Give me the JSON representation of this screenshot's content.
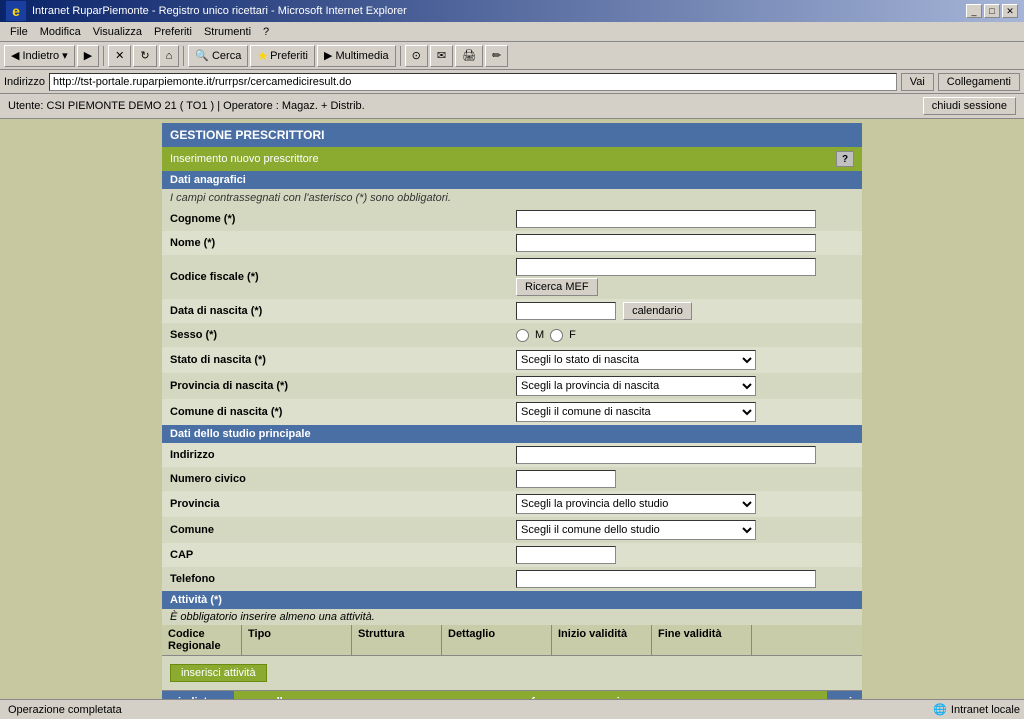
{
  "window": {
    "title": "Intranet RuparPiemonte - Registro unico ricettari - Microsoft Internet Explorer",
    "controls": [
      "_",
      "□",
      "✕"
    ]
  },
  "menu": {
    "items": [
      "File",
      "Modifica",
      "Visualizza",
      "Preferiti",
      "Strumenti",
      "?"
    ]
  },
  "toolbar": {
    "back": "Indietro",
    "forward": "▶",
    "stop": "✕",
    "refresh": "↻",
    "home": "⌂",
    "search": "Cerca",
    "favorites": "Preferiti",
    "multimedia": "Multimedia",
    "history": "⊙",
    "mail": "✉",
    "print": "🖨",
    "edit": "✏"
  },
  "address_bar": {
    "label": "Indirizzo",
    "url": "http://tst-portale.ruparpiemonte.it/rurrpsr/cercamediciresult.do",
    "go": "Vai",
    "links": "Collegamenti"
  },
  "user_bar": {
    "text": "Utente: CSI PIEMONTE DEMO 21 ( TO1 ) | Operatore : Magaz. + Distrib.",
    "close_session": "chiudi sessione"
  },
  "page": {
    "main_header": "GESTIONE PRESCRITTORI",
    "sub_header": "Inserimento nuovo prescrittore",
    "help_btn": "?",
    "sections": {
      "dati_anagrafici": {
        "title": "Dati anagrafici",
        "note": "I campi contrassegnati con l'asterisco (*) sono obbligatori.",
        "fields": {
          "cognome": {
            "label": "Cognome (*)",
            "value": "",
            "type": "text"
          },
          "nome": {
            "label": "Nome (*)",
            "value": "",
            "type": "text"
          },
          "codice_fiscale": {
            "label": "Codice fiscale (*)",
            "value": "",
            "type": "text"
          },
          "ricerca_mef": {
            "label": "Ricerca MEF",
            "type": "button"
          },
          "data_nascita": {
            "label": "Data di nascita (*)",
            "value": "",
            "type": "text",
            "calendar_btn": "calendario"
          },
          "sesso": {
            "label": "Sesso (*)",
            "options": [
              {
                "value": "M",
                "label": "M"
              },
              {
                "value": "F",
                "label": "F"
              }
            ],
            "type": "radio"
          },
          "stato_nascita": {
            "label": "Stato di nascita (*)",
            "placeholder": "Scegli lo stato di nascita",
            "type": "select"
          },
          "provincia_nascita": {
            "label": "Provincia di nascita (*)",
            "placeholder": "Scegli la provincia di nascita",
            "type": "select"
          },
          "comune_nascita": {
            "label": "Comune di nascita (*)",
            "placeholder": "Scegli il comune di nascita",
            "type": "select"
          }
        }
      },
      "dati_studio": {
        "title": "Dati dello studio principale",
        "fields": {
          "indirizzo": {
            "label": "Indirizzo",
            "value": "",
            "type": "text"
          },
          "numero_civico": {
            "label": "Numero civico",
            "value": "",
            "type": "text"
          },
          "provincia": {
            "label": "Provincia",
            "placeholder": "Scegli la provincia dello studio",
            "type": "select"
          },
          "comune": {
            "label": "Comune",
            "placeholder": "Scegli il comune dello studio",
            "type": "select"
          },
          "cap": {
            "label": "CAP",
            "value": "",
            "type": "text"
          },
          "telefono": {
            "label": "Telefono",
            "value": "",
            "type": "text"
          }
        }
      },
      "attivita": {
        "title": "Attività (*)",
        "note": "È obbligatorio inserire almeno una attività.",
        "table_headers": [
          "Codice Regionale",
          "Tipo",
          "Struttura",
          "Dettaglio",
          "Inizio validità",
          "Fine validità"
        ],
        "insert_btn": "inserisci attività"
      }
    },
    "buttons": {
      "back": "indietro",
      "annulla": "annulla",
      "conferma": "conferma e prosegui",
      "vai": "vai"
    }
  },
  "status_bar": {
    "text": "Operazione completata",
    "zone": "Intranet locale"
  }
}
